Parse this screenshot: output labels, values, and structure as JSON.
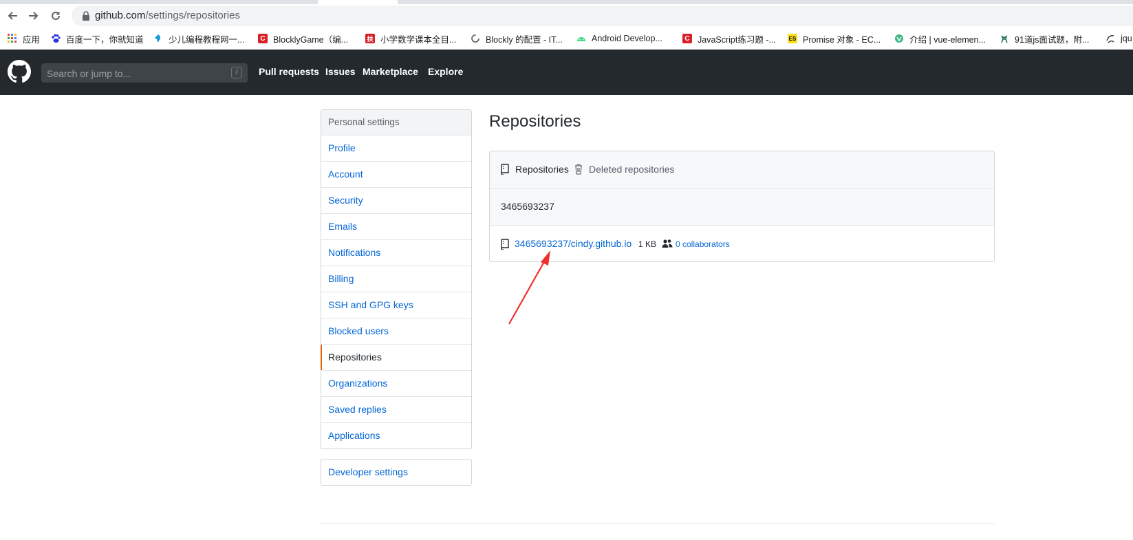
{
  "browser": {
    "url_host": "github.com",
    "url_path": "/settings/repositories",
    "bookmarks": [
      {
        "label": "应用",
        "icon": "apps-grid-icon"
      },
      {
        "label": "百度一下，你就知道",
        "icon": "baidu-paw-icon"
      },
      {
        "label": "少儿编程教程网一...",
        "icon": "bird-icon"
      },
      {
        "label": "BlocklyGame（编...",
        "icon": "c-logo-icon",
        "glyph": "C"
      },
      {
        "label": "小学数学课本全目...",
        "icon": "red-square-icon",
        "glyph": "扶"
      },
      {
        "label": "Blockly 的配置 - IT...",
        "icon": "circle-icon"
      },
      {
        "label": "Android Develop...",
        "icon": "android-icon"
      },
      {
        "label": "JavaScript练习题 -...",
        "icon": "c-logo-icon",
        "glyph": "C"
      },
      {
        "label": "Promise 对象 - EC...",
        "icon": "es-icon",
        "glyph": "ES"
      },
      {
        "label": "介绍 | vue-elemen...",
        "icon": "vue-icon"
      },
      {
        "label": "91道js面试题，附...",
        "icon": "deer-icon"
      },
      {
        "label": "jqu",
        "icon": "script-icon"
      }
    ]
  },
  "header": {
    "search_placeholder": "Search or jump to...",
    "search_key": "/",
    "nav": [
      "Pull requests",
      "Issues",
      "Marketplace",
      "Explore"
    ]
  },
  "sidebar": {
    "heading": "Personal settings",
    "items": [
      {
        "label": "Profile"
      },
      {
        "label": "Account"
      },
      {
        "label": "Security"
      },
      {
        "label": "Emails"
      },
      {
        "label": "Notifications"
      },
      {
        "label": "Billing"
      },
      {
        "label": "SSH and GPG keys"
      },
      {
        "label": "Blocked users"
      },
      {
        "label": "Repositories",
        "selected": true
      },
      {
        "label": "Organizations"
      },
      {
        "label": "Saved replies"
      },
      {
        "label": "Applications"
      }
    ],
    "developer_settings": "Developer settings"
  },
  "main": {
    "title": "Repositories",
    "tabs": [
      {
        "label": "Repositories",
        "icon": "repo-icon",
        "selected": true
      },
      {
        "label": "Deleted repositories",
        "icon": "trash-icon",
        "selected": false
      }
    ],
    "owner": "3465693237",
    "repos": [
      {
        "name": "3465693237/cindy.github.io",
        "size": "1 KB",
        "collaborators": "0 collaborators"
      }
    ]
  },
  "colors": {
    "link": "#0366d6",
    "header_bg": "#24292e",
    "selected_accent": "#e36209",
    "annotation_arrow": "#f0302c"
  }
}
